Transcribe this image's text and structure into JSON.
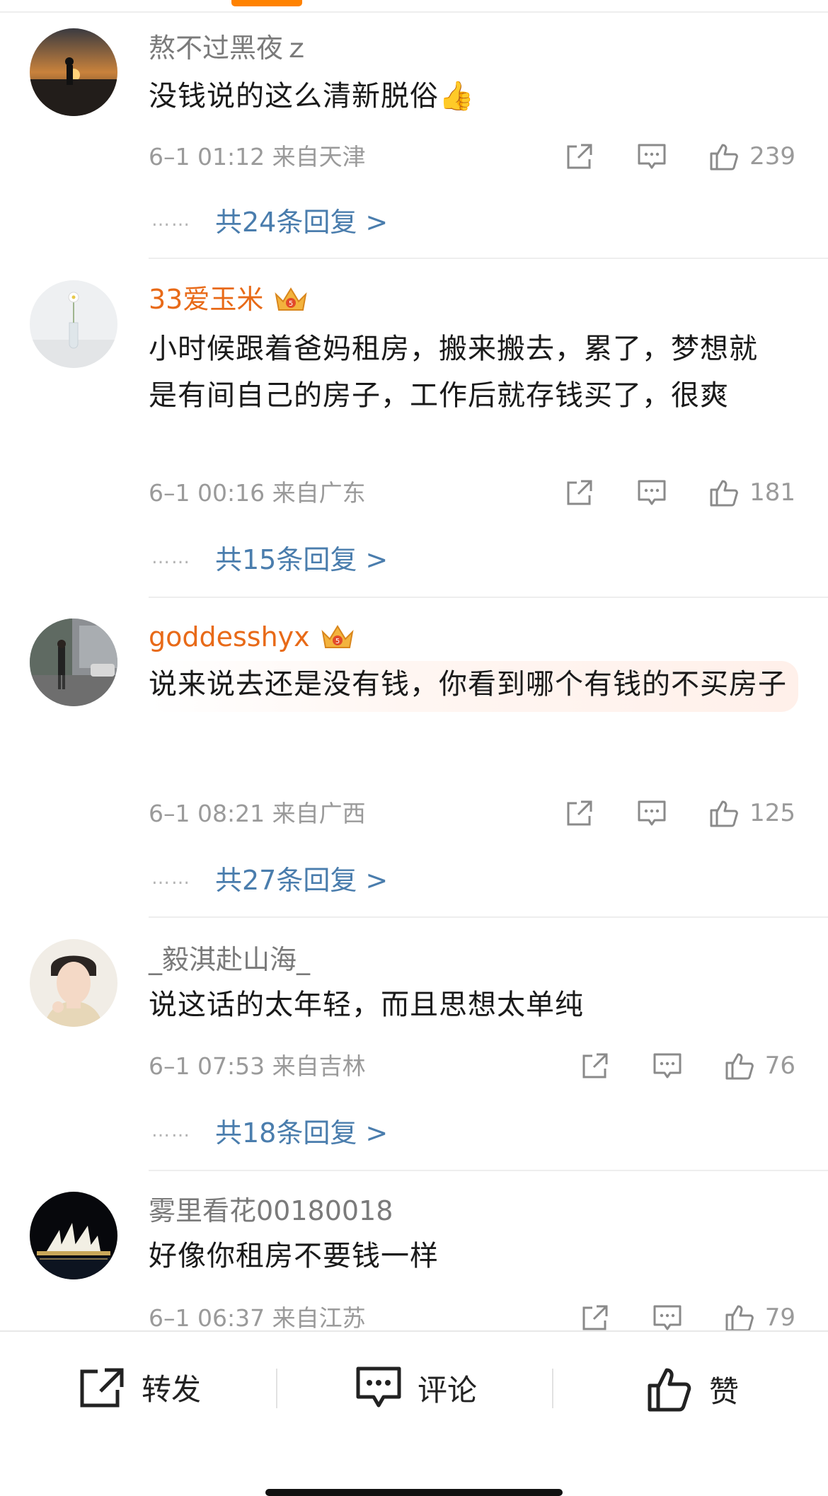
{
  "colors": {
    "accent": "#ff8200",
    "vip_name": "#e86a18",
    "link": "#4a7dad",
    "meta": "#9a9a9a"
  },
  "comments": [
    {
      "username": "熬不过黑夜ｚ",
      "text": "没钱说的这么清新脱俗👍",
      "time": "6–1 01:12",
      "location": "来自天津",
      "likes": "239",
      "replies": "共24条回复 >",
      "dots": "……",
      "avatar": "sunset-silhouette"
    },
    {
      "username": "33爱玉米",
      "text": "小时候跟着爸妈租房，搬来搬去，累了，梦想就是有间自己的房子，工作后就存钱买了，很爽",
      "time": "6–1 00:16",
      "location": "来自广东",
      "likes": "181",
      "replies": "共15条回复 >",
      "dots": "……",
      "avatar": "flower-vase"
    },
    {
      "username": "goddesshyx",
      "text": "说来说去还是没有钱，你看到哪个有钱的不买房子",
      "time": "6–1 08:21",
      "location": "来自广西",
      "likes": "125",
      "replies": "共27条回复 >",
      "dots": "……",
      "avatar": "street-walker"
    },
    {
      "username": "_毅淇赴山海_",
      "text": "说这话的太年轻，而且思想太单纯",
      "time": "6–1 07:53",
      "location": "来自吉林",
      "likes": "76",
      "replies": "共18条回复 >",
      "dots": "……",
      "avatar": "portrait"
    },
    {
      "username": "雾里看花00180018",
      "text": "好像你租房不要钱一样",
      "time": "6–1 06:37",
      "location": "来自江苏",
      "likes": "79",
      "avatar": "opera-house-night"
    }
  ],
  "bottom_bar": {
    "repost": "转发",
    "comment": "评论",
    "like": "赞"
  },
  "icons": [
    "share-icon",
    "comment-icon",
    "like-icon",
    "crown-badge-icon"
  ]
}
